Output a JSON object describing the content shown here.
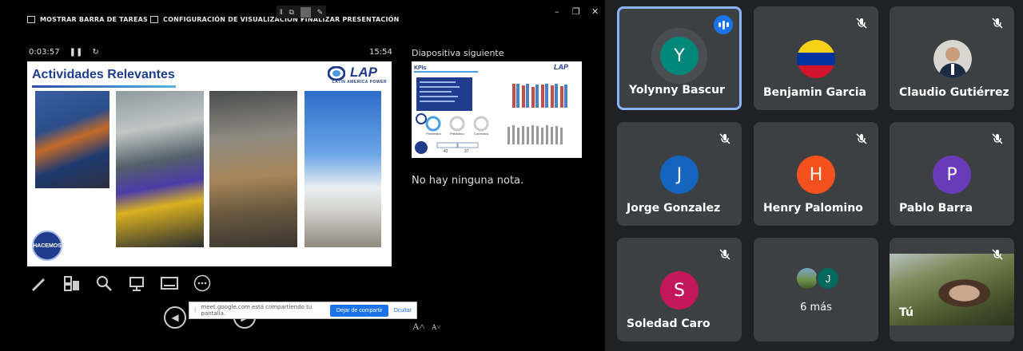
{
  "presenter": {
    "topbar": {
      "show_taskbar": "MOSTRAR BARRA DE TAREAS",
      "display_settings": "CONFIGURACIÓN DE VISUALIZACIÓN ▾",
      "end_show": "FINALIZAR PRESENTACIÓN"
    },
    "elapsed": "0:03:57",
    "clock": "15:54",
    "slide": {
      "title": "Actividades Relevantes",
      "logo_text": "LAP",
      "logo_sub": "LATIN AMERICA POWER",
      "badge": "HACEMOS"
    },
    "next_label": "Diapositiva siguiente",
    "next_slide": {
      "title": "KPIs",
      "logo_text": "LAP",
      "kpi_labels": [
        "Preventivo",
        "Predictivo",
        "Correctivo"
      ],
      "kpi_values": [
        "42",
        "37"
      ]
    },
    "notes": "No hay ninguna nota.",
    "share_banner": {
      "message": "meet.google.com está compartiendo tu pantalla.",
      "stop": "Dejar de compartir",
      "hide": "Ocultar"
    }
  },
  "participants": [
    {
      "name": "Yolynny Bascur",
      "initial": "Y",
      "color": "#00897b",
      "state": "speaking"
    },
    {
      "name": "Benjamin Garcia",
      "initial": "",
      "color": "#3c4043",
      "state": "muted",
      "avatar": "venezuela-flag"
    },
    {
      "name": "Claudio Gutiérrez",
      "initial": "",
      "color": "#3c4043",
      "state": "muted",
      "avatar": "photo"
    },
    {
      "name": "Jorge Gonzalez",
      "initial": "J",
      "color": "#1565c0",
      "state": "muted"
    },
    {
      "name": "Henry Palomino",
      "initial": "H",
      "color": "#f4511e",
      "state": "muted"
    },
    {
      "name": "Pablo Barra",
      "initial": "P",
      "color": "#6a3bb8",
      "state": "muted"
    },
    {
      "name": "Soledad Caro",
      "initial": "S",
      "color": "#c2185b",
      "state": "muted"
    },
    {
      "name": "6 más",
      "initial": "J",
      "color": "#00695c",
      "state": "none"
    },
    {
      "name": "Tú",
      "initial": "",
      "color": "#3c4043",
      "state": "muted",
      "avatar": "video"
    }
  ]
}
